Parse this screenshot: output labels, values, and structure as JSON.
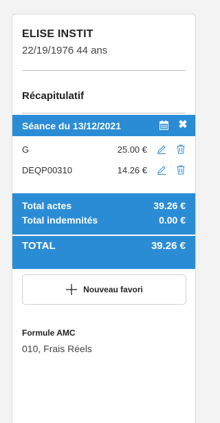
{
  "patient": {
    "name": "ELISE INSTIT",
    "info": "22/19/1976 44 ans"
  },
  "recap": {
    "title": "Récapitulatif"
  },
  "session": {
    "title": "Séance du 13/12/2021",
    "icons": {
      "calendar": "calendar-icon",
      "close": "close-icon"
    },
    "acts": [
      {
        "code": "G",
        "amount": "25.00 €"
      },
      {
        "code": "DEQP00310",
        "amount": "14.26 €"
      }
    ]
  },
  "totals": {
    "actes_label": "Total actes",
    "actes_value": "39.26 €",
    "indemnites_label": "Total indemnités",
    "indemnites_value": "0.00 €",
    "total_label": "TOTAL",
    "total_value": "39.26 €"
  },
  "favorite": {
    "button_label": "Nouveau favori"
  },
  "amc": {
    "title": "Formule AMC",
    "value": "010, Frais Réels"
  },
  "colors": {
    "accent": "#2b8cd6"
  }
}
